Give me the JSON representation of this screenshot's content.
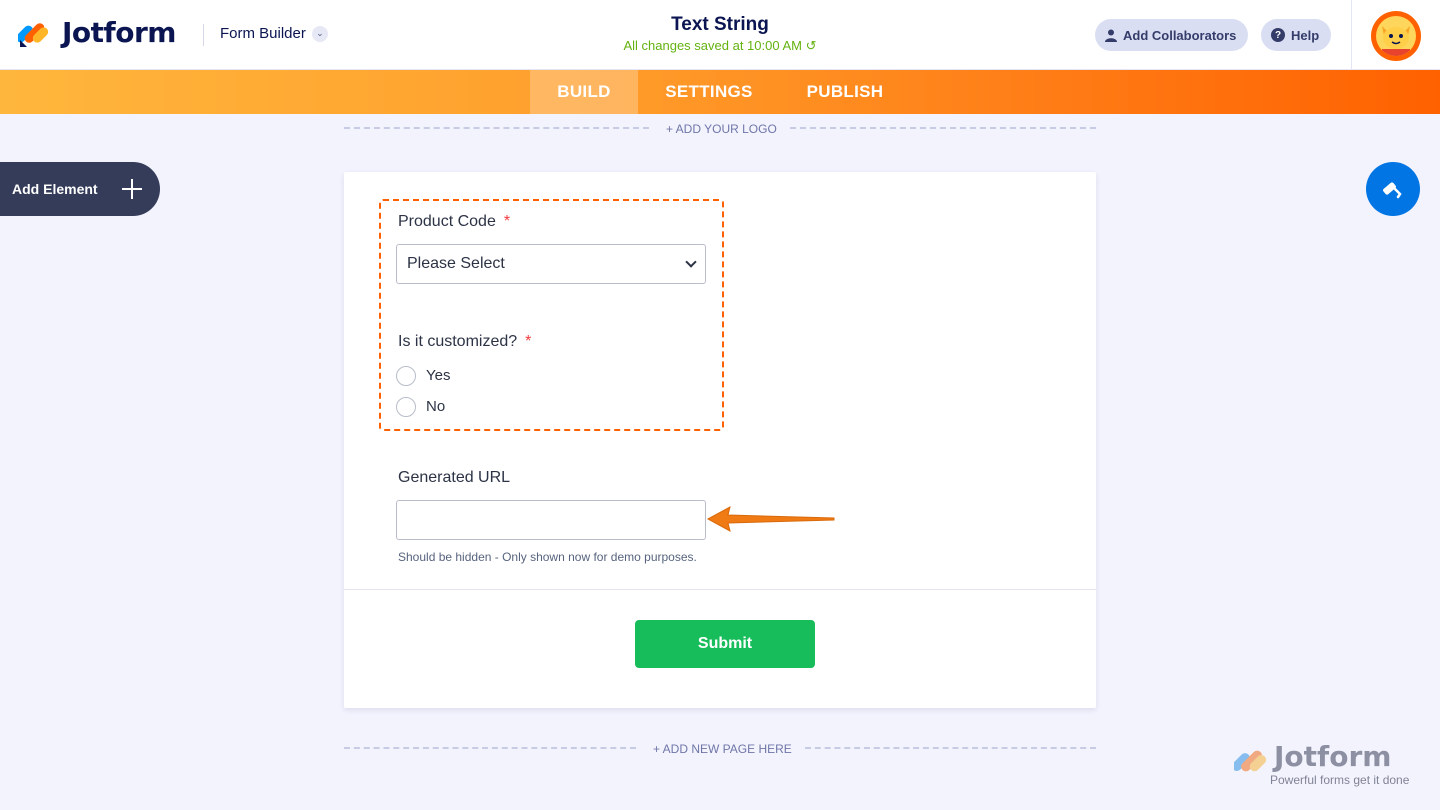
{
  "app": {
    "brand": "Jotform",
    "builder_label": "Form Builder"
  },
  "header": {
    "form_title": "Text String",
    "saved_status": "All changes saved at 10:00 AM",
    "add_collaborators": "Add Collaborators",
    "help": "Help"
  },
  "nav": {
    "tabs": [
      "BUILD",
      "SETTINGS",
      "PUBLISH"
    ],
    "active": "BUILD"
  },
  "canvas": {
    "add_logo": "+ ADD YOUR LOGO",
    "add_page": "+ ADD NEW PAGE HERE",
    "add_element": "Add Element"
  },
  "form": {
    "product_code": {
      "label": "Product Code",
      "required": "*",
      "placeholder": "Please Select"
    },
    "customized": {
      "label": "Is it customized?",
      "required": "*",
      "options": [
        "Yes",
        "No"
      ]
    },
    "generated_url": {
      "label": "Generated URL",
      "value": "",
      "sublabel": "Should be hidden - Only shown now for demo purposes."
    },
    "submit": "Submit"
  },
  "watermark": {
    "brand": "Jotform",
    "tagline": "Powerful forms get it done"
  },
  "colors": {
    "accent_orange": "#ff6100",
    "submit_green": "#18bd5b",
    "navy": "#0a1551",
    "designer_blue": "#0075e3"
  },
  "icons": [
    "jotform-logo-icon",
    "chevron-down-icon",
    "undo-icon",
    "user-icon",
    "help-icon",
    "plus-icon",
    "paint-roller-icon",
    "avatar-icon",
    "arrow-left-icon"
  ]
}
